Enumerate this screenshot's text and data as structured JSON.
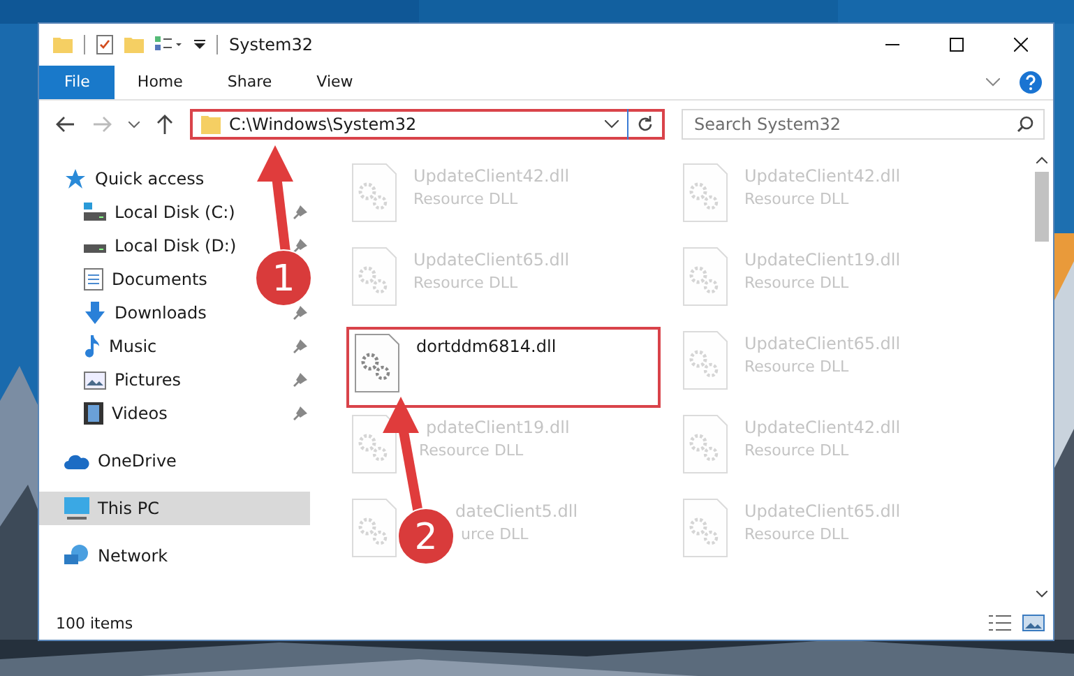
{
  "window": {
    "title": "System32"
  },
  "ribbon": {
    "tabs": [
      {
        "label": "File",
        "selected": true
      },
      {
        "label": "Home",
        "selected": false
      },
      {
        "label": "Share",
        "selected": false
      },
      {
        "label": "View",
        "selected": false
      }
    ]
  },
  "address": {
    "path": "C:\\Windows\\System32",
    "highlighted": true
  },
  "search": {
    "placeholder": "Search System32"
  },
  "sidebar": {
    "items": [
      {
        "label": "Quick access",
        "kind": "star",
        "selected": false,
        "children": [
          {
            "label": "Local Disk (C:)",
            "kind": "disk-c",
            "pinned": true,
            "selected": false
          },
          {
            "label": "Local Disk (D:)",
            "kind": "disk",
            "pinned": true,
            "selected": false
          },
          {
            "label": "Documents",
            "kind": "documents",
            "selected": false
          },
          {
            "label": "Downloads",
            "kind": "downloads",
            "pinned": true,
            "selected": false
          },
          {
            "label": "Music",
            "kind": "music",
            "pinned": true,
            "selected": false
          },
          {
            "label": "Pictures",
            "kind": "pictures",
            "pinned": true,
            "selected": false
          },
          {
            "label": "Videos",
            "kind": "videos",
            "pinned": true,
            "selected": false
          }
        ]
      },
      {
        "label": "OneDrive",
        "kind": "cloud",
        "selected": false
      },
      {
        "label": "This PC",
        "kind": "pc",
        "selected": true
      },
      {
        "label": "Network",
        "kind": "network",
        "selected": false
      }
    ]
  },
  "files": [
    {
      "name": "UpdateClient42.dll",
      "type": "Resource DLL",
      "faded": true,
      "highlighted": false
    },
    {
      "name": "UpdateClient42.dll",
      "type": "Resource DLL",
      "faded": true,
      "highlighted": false
    },
    {
      "name": "UpdateClient65.dll",
      "type": "Resource DLL",
      "faded": true,
      "highlighted": false
    },
    {
      "name": "UpdateClient19.dll",
      "type": "Resource DLL",
      "faded": true,
      "highlighted": false
    },
    {
      "name": "dortddm6814.dll",
      "faded": false,
      "highlighted": true
    },
    {
      "name": "UpdateClient65.dll",
      "type": "Resource DLL",
      "faded": true,
      "highlighted": false
    },
    {
      "name": "pdateClient19.dll",
      "type": "Resource DLL",
      "faded": true,
      "highlighted": false
    },
    {
      "name": "UpdateClient42.dll",
      "type": "Resource DLL",
      "faded": true,
      "highlighted": false
    },
    {
      "name": "dateClient5.dll",
      "type": "urce DLL",
      "faded": true,
      "highlighted": false
    },
    {
      "name": "UpdateClient65.dll",
      "type": "Resource DLL",
      "faded": true,
      "highlighted": false
    }
  ],
  "status_bar": {
    "count": "100 items"
  },
  "annotations": [
    {
      "number": "1"
    },
    {
      "number": "2"
    }
  ]
}
